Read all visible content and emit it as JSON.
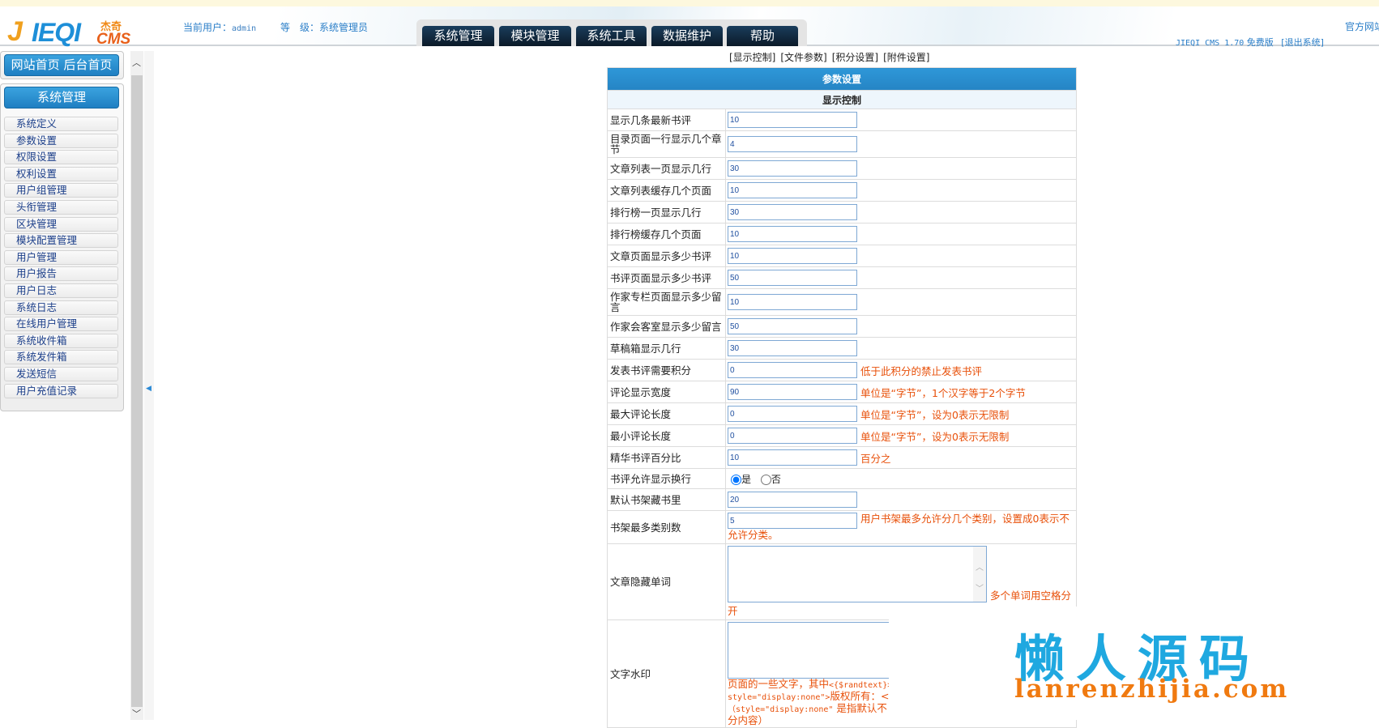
{
  "header": {
    "logo_text": "JIEQI CMS 杰奇",
    "user_label": "当前用户：",
    "user_name": "admin",
    "level_label": "等　级：",
    "level_value": "系统管理员",
    "tabs": [
      "系统管理",
      "模块管理",
      "系统工具",
      "数据维护",
      "帮助"
    ],
    "official_site": "官方网站",
    "version_prefix": "JIEQI CMS 1.70",
    "version_suffix": "免费版",
    "logout": "[退出系统]"
  },
  "sidebar": {
    "home_button": "网站首页 后台首页",
    "section_button": "系统管理",
    "items": [
      "系统定义",
      "参数设置",
      "权限设置",
      "权利设置",
      "用户组管理",
      "头衔管理",
      "区块管理",
      "模块配置管理",
      "用户管理",
      "用户报告",
      "用户日志",
      "系统日志",
      "在线用户管理",
      "系统收件箱",
      "系统发件箱",
      "发送短信",
      "用户充值记录"
    ]
  },
  "subnav": [
    "[显示控制]",
    "[文件参数]",
    "[积分设置]",
    "[附件设置]"
  ],
  "form": {
    "title": "参数设置",
    "section": "显示控制",
    "rows": [
      {
        "label": "显示几条最新书评",
        "value": "10",
        "hint": ""
      },
      {
        "label": "目录页面一行显示几个章节",
        "value": "4",
        "hint": ""
      },
      {
        "label": "文章列表一页显示几行",
        "value": "30",
        "hint": ""
      },
      {
        "label": "文章列表缓存几个页面",
        "value": "10",
        "hint": ""
      },
      {
        "label": "排行榜一页显示几行",
        "value": "30",
        "hint": ""
      },
      {
        "label": "排行榜缓存几个页面",
        "value": "10",
        "hint": ""
      },
      {
        "label": "文章页面显示多少书评",
        "value": "10",
        "hint": ""
      },
      {
        "label": "书评页面显示多少书评",
        "value": "50",
        "hint": ""
      },
      {
        "label": "作家专栏页面显示多少留言",
        "value": "10",
        "hint": ""
      },
      {
        "label": "作家会客室显示多少留言",
        "value": "50",
        "hint": ""
      },
      {
        "label": "草稿箱显示几行",
        "value": "30",
        "hint": ""
      },
      {
        "label": "发表书评需要积分",
        "value": "0",
        "hint": "低于此积分的禁止发表书评"
      },
      {
        "label": "评论显示宽度",
        "value": "90",
        "hint": "单位是“字节”，1个汉字等于2个字节"
      },
      {
        "label": "最大评论长度",
        "value": "0",
        "hint": "单位是“字节”，设为0表示无限制"
      },
      {
        "label": "最小评论长度",
        "value": "0",
        "hint": "单位是“字节”，设为0表示无限制"
      },
      {
        "label": "精华书评百分比",
        "value": "10",
        "hint": "百分之"
      }
    ],
    "linebreak": {
      "label": "书评允许显示换行",
      "yes": "是",
      "no": "否",
      "selected": "是"
    },
    "shelf": {
      "label": "默认书架藏书里",
      "value": "20"
    },
    "category": {
      "label": "书架最多类别数",
      "value": "5",
      "hint": "用户书架最多允许分几个类别，设置成0表示不允许分类。"
    },
    "hidden_words": {
      "label": "文章隐藏单词",
      "value": "",
      "hint": "多个单词用空格分开"
    },
    "watermark": {
      "label": "文字水印",
      "value": "",
      "hint1": "页面的一些文字，其中",
      "code1": "<{$randtext}>",
      "hint2_code": "style=\"display:none\">",
      "hint2": "版权所有：<{",
      "hint3_code": "（style=\"display:none\"",
      "hint3": " 是指默认不",
      "hint4": "分内容）"
    }
  },
  "overlay": {
    "cn": "懒人源码",
    "en": "lanrenzhijia.com"
  }
}
